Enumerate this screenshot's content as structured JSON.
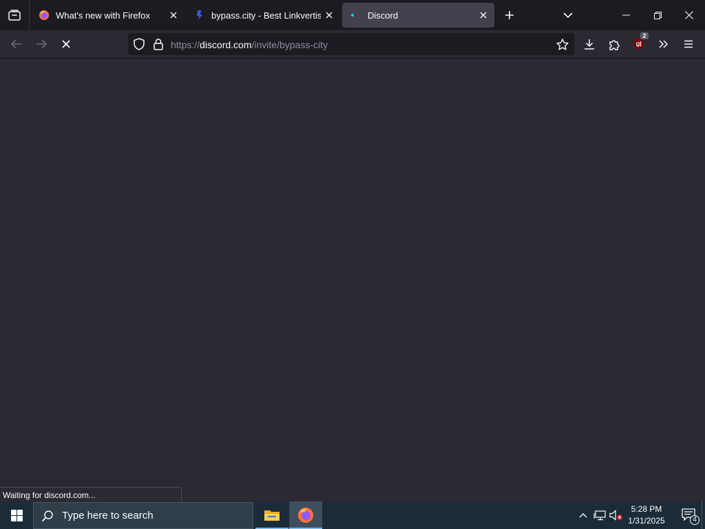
{
  "browser": {
    "tabs": [
      {
        "title": "What's new with Firefox",
        "favicon": "firefox-icon",
        "active": false
      },
      {
        "title": "bypass.city - Best Linkvertise &",
        "favicon": "bypass-city-icon",
        "active": false
      },
      {
        "title": "Discord",
        "favicon": "loading-dot-icon",
        "active": true
      }
    ],
    "url": {
      "prefix": "https://",
      "host": "discord.com",
      "path": "/invite/bypass-city"
    },
    "extension_badge": "2",
    "status_text": "Waiting for discord.com..."
  },
  "taskbar": {
    "search_placeholder": "Type here to search",
    "time": "5:28 PM",
    "date": "1/31/2025",
    "notification_count": "4"
  },
  "colors": {
    "accent": "#00ddff",
    "tab_active": "#42414d",
    "toolbar": "#2b2a33",
    "tabstrip": "#1c1b22",
    "ublock_red": "#800000",
    "taskbar": "#1b2b37"
  }
}
